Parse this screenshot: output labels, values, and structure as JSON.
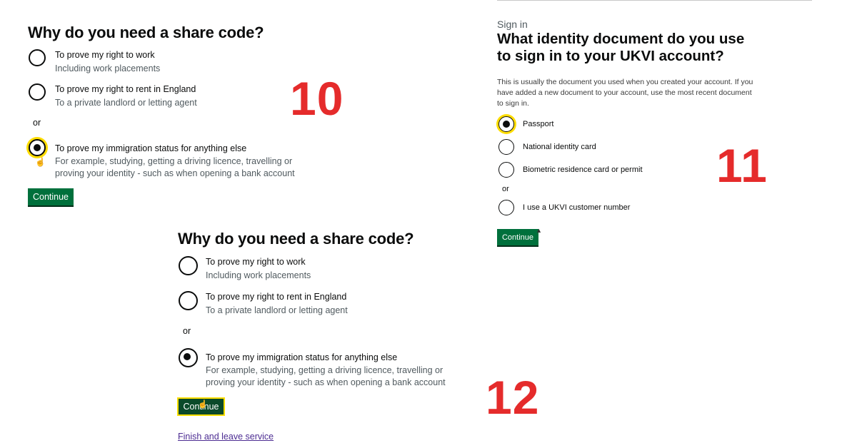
{
  "panel10": {
    "title": "Why do you need a share code?",
    "options": [
      {
        "label": "To prove my right to work",
        "hint": "Including work placements"
      },
      {
        "label": "To prove my right to rent in England",
        "hint": "To a private landlord or letting agent"
      },
      {
        "label": "To prove my immigration status for anything else",
        "hint_line1": "For example, studying, getting a driving licence, travelling or",
        "hint_line2": "proving your identity - such as when opening a bank account"
      }
    ],
    "or": "or",
    "selected_index": 2,
    "continue": "Continue",
    "step_number": "10"
  },
  "panel11": {
    "caption": "Sign in",
    "title_line1": "What identity document do you use",
    "title_line2": "to sign in to your UKVI account?",
    "para": "This is usually the document you used when you created your account. If you have added a new document to your account, use the most recent document to sign in.",
    "options": [
      "Passport",
      "National identity card",
      "Biometric residence card or permit",
      "I use a UKVI customer number"
    ],
    "or": "or",
    "selected_index": 0,
    "continue": "Continue",
    "step_number": "11"
  },
  "panel12": {
    "title": "Why do you need a share code?",
    "options": [
      {
        "label": "To prove my right to work",
        "hint": "Including work placements"
      },
      {
        "label": "To prove my right to rent in England",
        "hint": "To a private landlord or letting agent"
      },
      {
        "label": "To prove my immigration status for anything else",
        "hint_line1": "For example, studying, getting a driving licence, travelling or",
        "hint_line2": "proving your identity - such as when opening a bank account"
      }
    ],
    "or": "or",
    "selected_index": 2,
    "continue": "Continue",
    "finish_link": "Finish and leave service",
    "step_number": "12"
  },
  "colors": {
    "button_green": "#00703c",
    "focus_yellow": "#ffdd00",
    "step_number_red": "#e52b2b",
    "link_purple": "#4c2c92",
    "hint_grey": "#505a5f"
  }
}
